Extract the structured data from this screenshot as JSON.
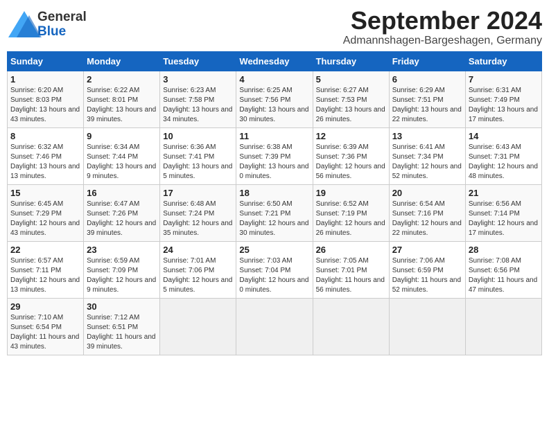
{
  "header": {
    "title": "September 2024",
    "subtitle": "Admannshagen-Bargeshagen, Germany",
    "logo_general": "General",
    "logo_blue": "Blue"
  },
  "weekdays": [
    "Sunday",
    "Monday",
    "Tuesday",
    "Wednesday",
    "Thursday",
    "Friday",
    "Saturday"
  ],
  "weeks": [
    [
      {
        "day": "1",
        "sunrise": "Sunrise: 6:20 AM",
        "sunset": "Sunset: 8:03 PM",
        "daylight": "Daylight: 13 hours and 43 minutes."
      },
      {
        "day": "2",
        "sunrise": "Sunrise: 6:22 AM",
        "sunset": "Sunset: 8:01 PM",
        "daylight": "Daylight: 13 hours and 39 minutes."
      },
      {
        "day": "3",
        "sunrise": "Sunrise: 6:23 AM",
        "sunset": "Sunset: 7:58 PM",
        "daylight": "Daylight: 13 hours and 34 minutes."
      },
      {
        "day": "4",
        "sunrise": "Sunrise: 6:25 AM",
        "sunset": "Sunset: 7:56 PM",
        "daylight": "Daylight: 13 hours and 30 minutes."
      },
      {
        "day": "5",
        "sunrise": "Sunrise: 6:27 AM",
        "sunset": "Sunset: 7:53 PM",
        "daylight": "Daylight: 13 hours and 26 minutes."
      },
      {
        "day": "6",
        "sunrise": "Sunrise: 6:29 AM",
        "sunset": "Sunset: 7:51 PM",
        "daylight": "Daylight: 13 hours and 22 minutes."
      },
      {
        "day": "7",
        "sunrise": "Sunrise: 6:31 AM",
        "sunset": "Sunset: 7:49 PM",
        "daylight": "Daylight: 13 hours and 17 minutes."
      }
    ],
    [
      {
        "day": "8",
        "sunrise": "Sunrise: 6:32 AM",
        "sunset": "Sunset: 7:46 PM",
        "daylight": "Daylight: 13 hours and 13 minutes."
      },
      {
        "day": "9",
        "sunrise": "Sunrise: 6:34 AM",
        "sunset": "Sunset: 7:44 PM",
        "daylight": "Daylight: 13 hours and 9 minutes."
      },
      {
        "day": "10",
        "sunrise": "Sunrise: 6:36 AM",
        "sunset": "Sunset: 7:41 PM",
        "daylight": "Daylight: 13 hours and 5 minutes."
      },
      {
        "day": "11",
        "sunrise": "Sunrise: 6:38 AM",
        "sunset": "Sunset: 7:39 PM",
        "daylight": "Daylight: 13 hours and 0 minutes."
      },
      {
        "day": "12",
        "sunrise": "Sunrise: 6:39 AM",
        "sunset": "Sunset: 7:36 PM",
        "daylight": "Daylight: 12 hours and 56 minutes."
      },
      {
        "day": "13",
        "sunrise": "Sunrise: 6:41 AM",
        "sunset": "Sunset: 7:34 PM",
        "daylight": "Daylight: 12 hours and 52 minutes."
      },
      {
        "day": "14",
        "sunrise": "Sunrise: 6:43 AM",
        "sunset": "Sunset: 7:31 PM",
        "daylight": "Daylight: 12 hours and 48 minutes."
      }
    ],
    [
      {
        "day": "15",
        "sunrise": "Sunrise: 6:45 AM",
        "sunset": "Sunset: 7:29 PM",
        "daylight": "Daylight: 12 hours and 43 minutes."
      },
      {
        "day": "16",
        "sunrise": "Sunrise: 6:47 AM",
        "sunset": "Sunset: 7:26 PM",
        "daylight": "Daylight: 12 hours and 39 minutes."
      },
      {
        "day": "17",
        "sunrise": "Sunrise: 6:48 AM",
        "sunset": "Sunset: 7:24 PM",
        "daylight": "Daylight: 12 hours and 35 minutes."
      },
      {
        "day": "18",
        "sunrise": "Sunrise: 6:50 AM",
        "sunset": "Sunset: 7:21 PM",
        "daylight": "Daylight: 12 hours and 30 minutes."
      },
      {
        "day": "19",
        "sunrise": "Sunrise: 6:52 AM",
        "sunset": "Sunset: 7:19 PM",
        "daylight": "Daylight: 12 hours and 26 minutes."
      },
      {
        "day": "20",
        "sunrise": "Sunrise: 6:54 AM",
        "sunset": "Sunset: 7:16 PM",
        "daylight": "Daylight: 12 hours and 22 minutes."
      },
      {
        "day": "21",
        "sunrise": "Sunrise: 6:56 AM",
        "sunset": "Sunset: 7:14 PM",
        "daylight": "Daylight: 12 hours and 17 minutes."
      }
    ],
    [
      {
        "day": "22",
        "sunrise": "Sunrise: 6:57 AM",
        "sunset": "Sunset: 7:11 PM",
        "daylight": "Daylight: 12 hours and 13 minutes."
      },
      {
        "day": "23",
        "sunrise": "Sunrise: 6:59 AM",
        "sunset": "Sunset: 7:09 PM",
        "daylight": "Daylight: 12 hours and 9 minutes."
      },
      {
        "day": "24",
        "sunrise": "Sunrise: 7:01 AM",
        "sunset": "Sunset: 7:06 PM",
        "daylight": "Daylight: 12 hours and 5 minutes."
      },
      {
        "day": "25",
        "sunrise": "Sunrise: 7:03 AM",
        "sunset": "Sunset: 7:04 PM",
        "daylight": "Daylight: 12 hours and 0 minutes."
      },
      {
        "day": "26",
        "sunrise": "Sunrise: 7:05 AM",
        "sunset": "Sunset: 7:01 PM",
        "daylight": "Daylight: 11 hours and 56 minutes."
      },
      {
        "day": "27",
        "sunrise": "Sunrise: 7:06 AM",
        "sunset": "Sunset: 6:59 PM",
        "daylight": "Daylight: 11 hours and 52 minutes."
      },
      {
        "day": "28",
        "sunrise": "Sunrise: 7:08 AM",
        "sunset": "Sunset: 6:56 PM",
        "daylight": "Daylight: 11 hours and 47 minutes."
      }
    ],
    [
      {
        "day": "29",
        "sunrise": "Sunrise: 7:10 AM",
        "sunset": "Sunset: 6:54 PM",
        "daylight": "Daylight: 11 hours and 43 minutes."
      },
      {
        "day": "30",
        "sunrise": "Sunrise: 7:12 AM",
        "sunset": "Sunset: 6:51 PM",
        "daylight": "Daylight: 11 hours and 39 minutes."
      },
      null,
      null,
      null,
      null,
      null
    ]
  ]
}
